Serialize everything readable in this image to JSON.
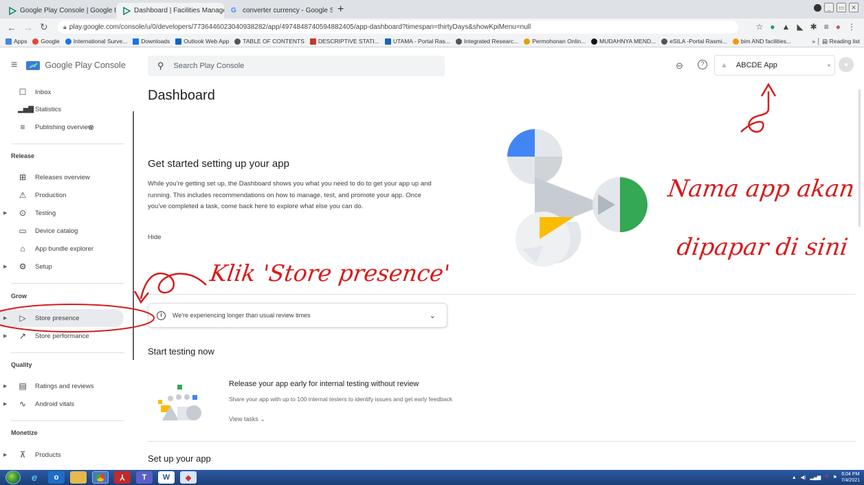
{
  "browser": {
    "tabs": [
      {
        "label": "Google Play Console | Google Pl",
        "active": false
      },
      {
        "label": "Dashboard | Facilities Manageme",
        "active": true
      },
      {
        "label": "converter currency - Google Sea",
        "active": false
      }
    ],
    "new_tab": "+",
    "url": "play.google.com/console/u/0/developers/7736446023040938282/app/4974848740594882405/app-dashboard?timespan=thirtyDays&showKpiMenu=null",
    "bookmarks": [
      "Apps",
      "Google",
      "International Surve...",
      "Downloads",
      "Outlook Web App",
      "TABLE OF CONTENTS",
      "DESCRIPTIVE STATI...",
      "UTAMA - Portal Ras...",
      "Integrated Researc...",
      "Permohonan Onlin...",
      "MUDAHNYA MEND...",
      "eSILA -Portal Rasmi...",
      "bim AND facilities..."
    ],
    "reading_list": "Reading list"
  },
  "app": {
    "brand": "Google Play Console",
    "search_placeholder": "Search Play Console",
    "app_name": "ABCDE App",
    "nav": {
      "top": [
        {
          "label": "Inbox",
          "icon": "inbox-icon"
        },
        {
          "label": "Statistics",
          "icon": "bar-chart-icon"
        },
        {
          "label": "Publishing overview",
          "icon": "publishing-icon"
        }
      ],
      "release_header": "Release",
      "release": [
        {
          "label": "Releases overview",
          "icon": "grid-icon"
        },
        {
          "label": "Production",
          "icon": "production-icon"
        },
        {
          "label": "Testing",
          "icon": "testing-icon"
        },
        {
          "label": "Device catalog",
          "icon": "device-icon"
        },
        {
          "label": "App bundle explorer",
          "icon": "bundle-icon"
        },
        {
          "label": "Setup",
          "icon": "gear-icon"
        }
      ],
      "grow_header": "Grow",
      "grow": [
        {
          "label": "Store presence",
          "icon": "play-icon"
        },
        {
          "label": "Store performance",
          "icon": "trend-icon"
        }
      ],
      "quality_header": "Quality",
      "quality": [
        {
          "label": "Ratings and reviews",
          "icon": "reviews-icon"
        },
        {
          "label": "Android vitals",
          "icon": "vitals-icon"
        }
      ],
      "monetize_header": "Monetize",
      "monetize": [
        {
          "label": "Products",
          "icon": "cart-icon"
        }
      ]
    },
    "dashboard": {
      "title": "Dashboard",
      "get_started_title": "Get started setting up your app",
      "get_started_body": "While you're getting set up, the Dashboard shows you what you need to do to get your app up and running. This includes recommendations on how to manage, test, and promote your app. Once you've completed a task, come back here to explore what else you can do.",
      "hide": "Hide",
      "notice": "We're experiencing longer than usual review times",
      "start_testing_title": "Start testing now",
      "release_title": "Release your app early for internal testing without review",
      "release_body": "Share your app with up to 100 internal testers to identify issues and get early feedback",
      "view_tasks": "View tasks",
      "setup_title": "Set up your app"
    }
  },
  "annotations": {
    "klik": "Klik 'Store presence'",
    "nama_line1": "Nama app akan",
    "nama_line2": "dipapar di sini"
  },
  "taskbar": {
    "time": "6:04 PM",
    "date": "7/4/2021"
  },
  "colors": {
    "annotation_red": "#d81b1b",
    "play_blue": "#4285f4",
    "play_green": "#34a853",
    "play_yellow": "#fbbc04"
  }
}
